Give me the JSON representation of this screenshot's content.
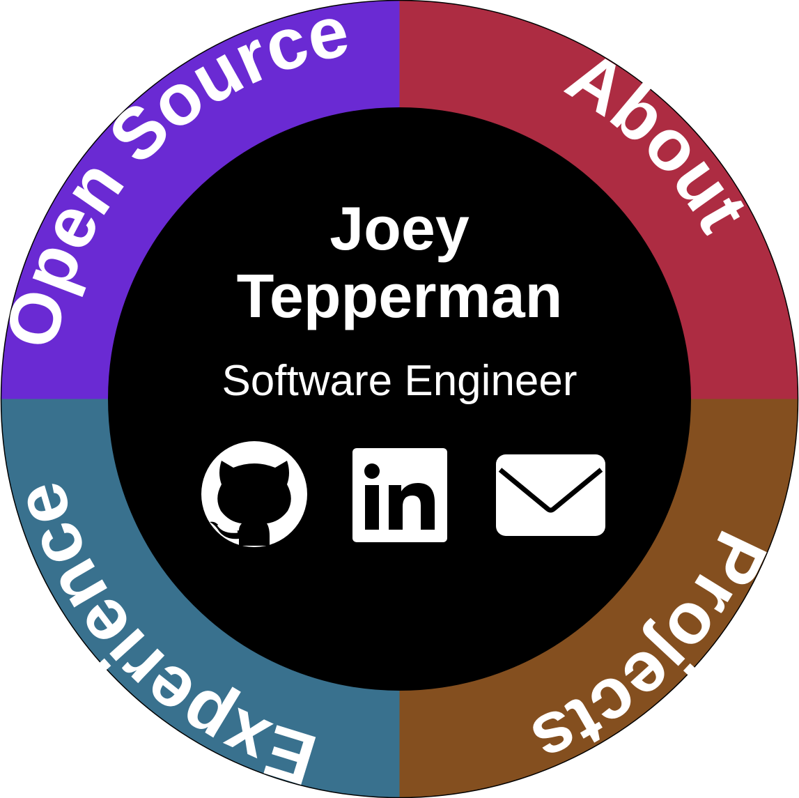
{
  "segments": {
    "about": {
      "label": "About",
      "color": "#ad2c42"
    },
    "projects": {
      "label": "Projects",
      "color": "#844f1f"
    },
    "experience": {
      "label": "Experience",
      "color": "#39718e"
    },
    "open_source": {
      "label": "Open Source",
      "color": "#6a2ad3"
    }
  },
  "center": {
    "first_name": "Joey",
    "last_name": "Tepperman",
    "role": "Software Engineer",
    "background": "#000000"
  },
  "icons": {
    "github": "github-icon",
    "linkedin": "linkedin-icon",
    "email": "email-icon",
    "linkedin_text": "in"
  }
}
